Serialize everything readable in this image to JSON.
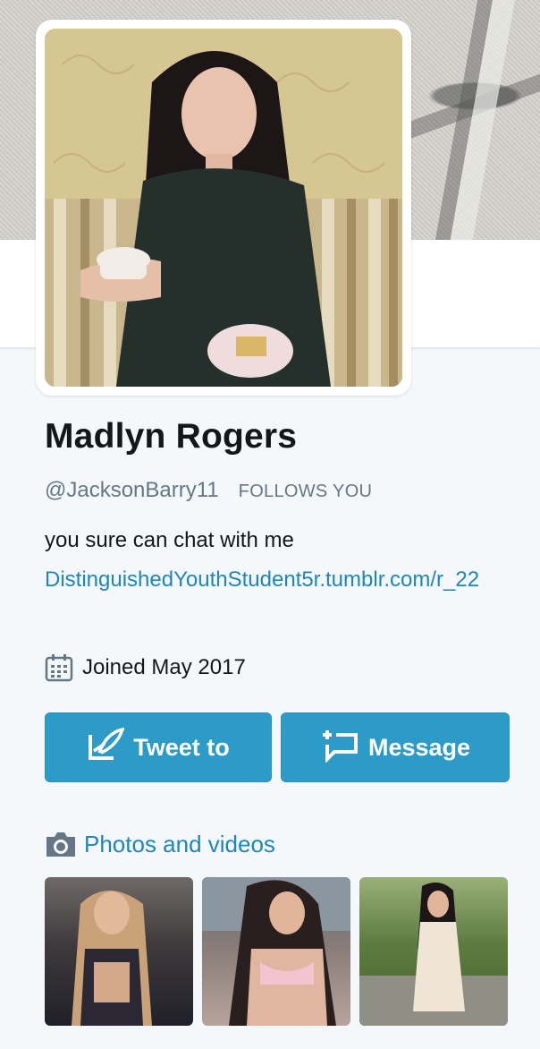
{
  "profile": {
    "name": "Madlyn Rogers",
    "handle": "@JacksonBarry11",
    "follows_you": "FOLLOWS YOU",
    "bio": "you sure can chat with me",
    "link": "DistinguishedYouthStudent5r.tumblr.com/r_22",
    "joined": "Joined May 2017"
  },
  "actions": {
    "tweet_label": "Tweet to",
    "message_label": "Message"
  },
  "media": {
    "section_label": "Photos and videos",
    "thumbnails": [
      "photo-1",
      "photo-2",
      "photo-3"
    ]
  },
  "icons": {
    "calendar": "calendar-icon",
    "tweet": "compose-quill-icon",
    "message": "new-message-icon",
    "camera": "camera-icon"
  },
  "colors": {
    "accent": "#2d9bc8",
    "link": "#1f86b8",
    "muted": "#657786",
    "background": "#f5f8fa"
  }
}
